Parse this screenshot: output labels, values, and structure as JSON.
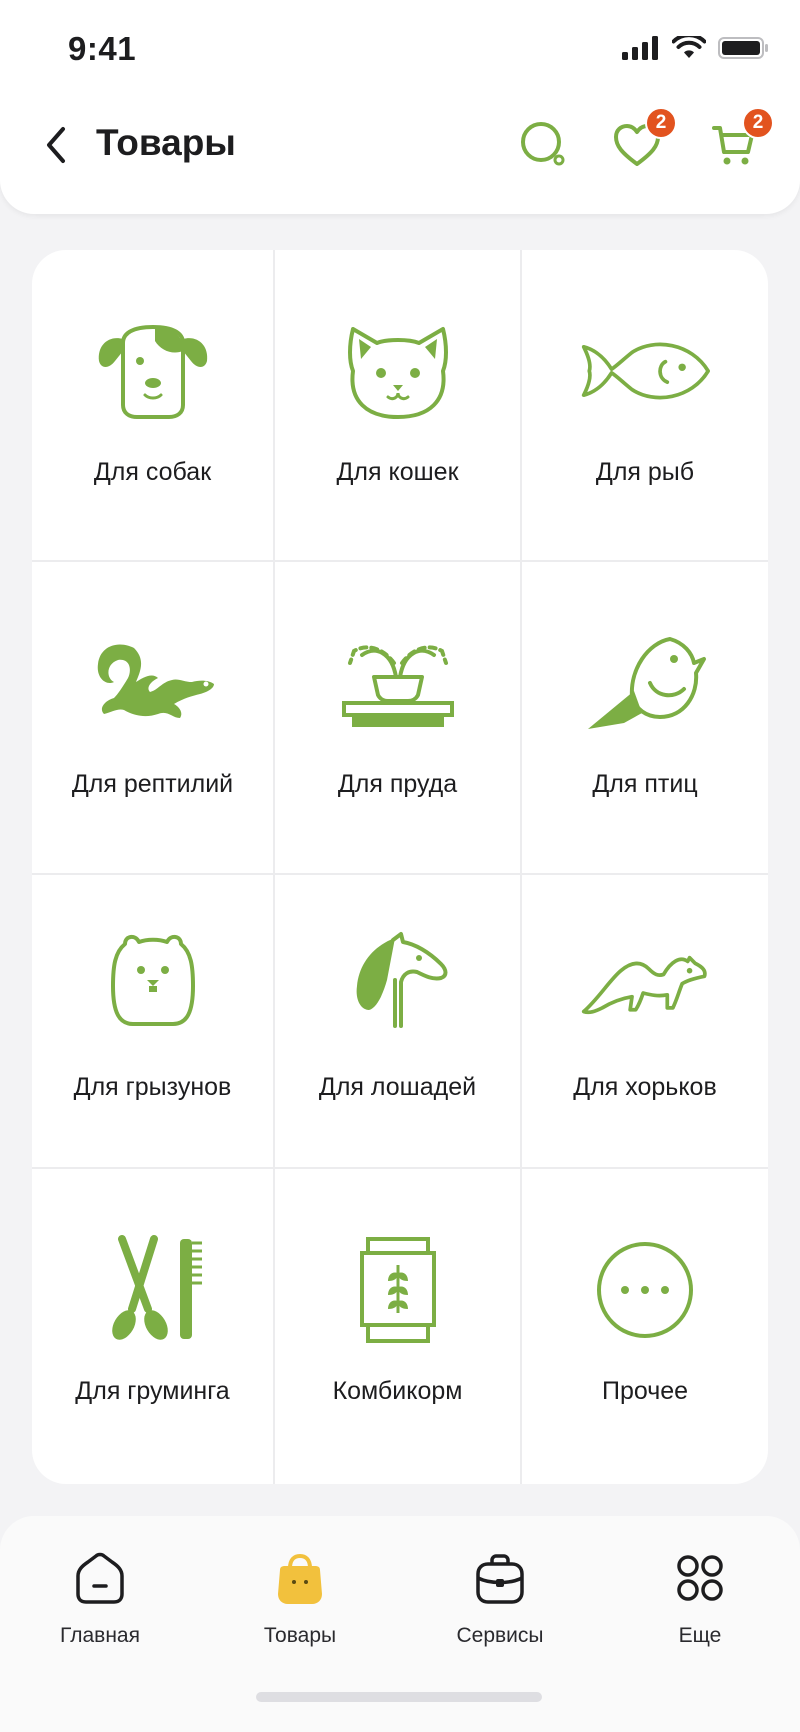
{
  "status_bar": {
    "time": "9:41"
  },
  "header": {
    "title": "Товары",
    "wishlist_badge": "2",
    "cart_badge": "2"
  },
  "colors": {
    "accent_green": "#7cae44",
    "badge": "#e2531f",
    "active_tab": "#f2c13d"
  },
  "categories": [
    {
      "label": "Для собак",
      "icon": "dog-icon"
    },
    {
      "label": "Для кошек",
      "icon": "cat-icon"
    },
    {
      "label": "Для рыб",
      "icon": "fish-icon"
    },
    {
      "label": "Для рептилий",
      "icon": "lizard-icon"
    },
    {
      "label": "Для пруда",
      "icon": "pond-fountain-icon"
    },
    {
      "label": "Для птиц",
      "icon": "bird-icon"
    },
    {
      "label": "Для грызунов",
      "icon": "rodent-icon"
    },
    {
      "label": "Для лошадей",
      "icon": "horse-icon"
    },
    {
      "label": "Для хорьков",
      "icon": "ferret-icon"
    },
    {
      "label": "Для груминга",
      "icon": "grooming-icon"
    },
    {
      "label": "Комбикорм",
      "icon": "feed-bag-icon"
    },
    {
      "label": "Прочее",
      "icon": "more-icon"
    }
  ],
  "tabbar": {
    "items": [
      {
        "label": "Главная",
        "icon": "home-icon",
        "active": false
      },
      {
        "label": "Товары",
        "icon": "shopping-bag-icon",
        "active": true
      },
      {
        "label": "Сервисы",
        "icon": "briefcase-icon",
        "active": false
      },
      {
        "label": "Еще",
        "icon": "grid-more-icon",
        "active": false
      }
    ]
  }
}
